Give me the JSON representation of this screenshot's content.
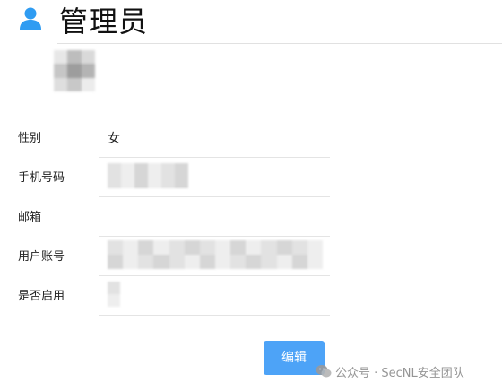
{
  "header": {
    "title": "管理员",
    "icon": "user-icon",
    "icon_color": "#2f9cf2"
  },
  "profile": {
    "avatar": "avatar-image",
    "fields": [
      {
        "label": "性别",
        "value": "女"
      },
      {
        "label": "手机号码",
        "value": ""
      },
      {
        "label": "邮箱",
        "value": ""
      },
      {
        "label": "用户账号",
        "value": ""
      },
      {
        "label": "是否启用",
        "value": ""
      }
    ]
  },
  "actions": {
    "edit_label": "编辑",
    "edit_color": "#4da3f7"
  },
  "watermark": {
    "icon": "wechat-icon",
    "text": "公众号 · SecNL安全团队"
  }
}
